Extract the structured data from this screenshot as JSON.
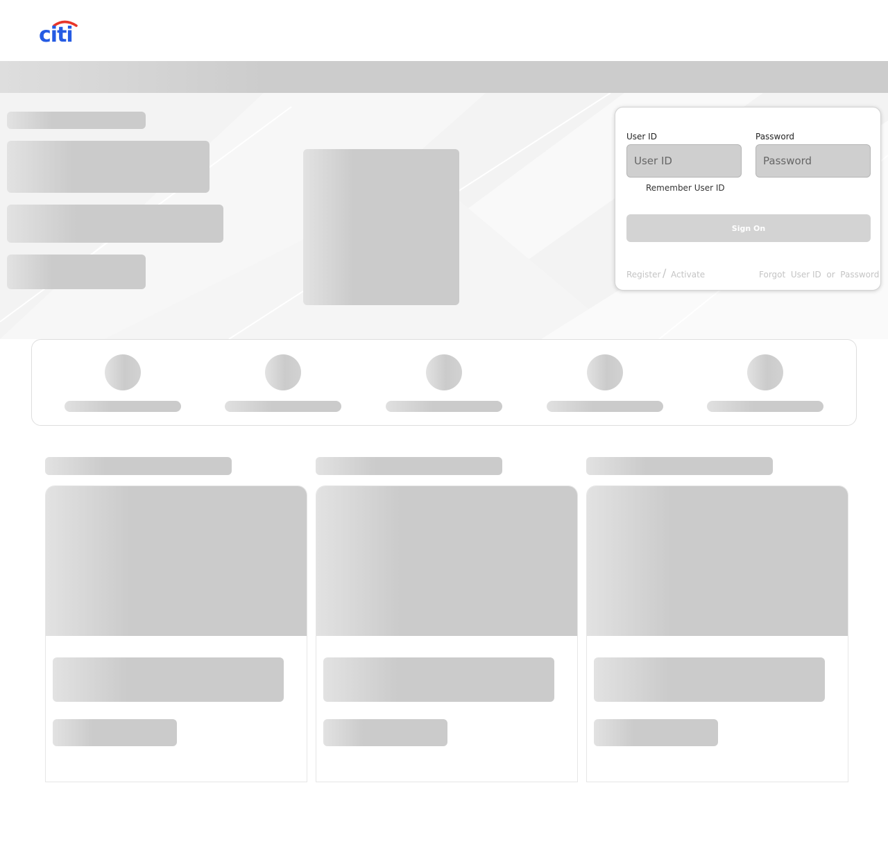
{
  "brand": {
    "logo_text": "citi",
    "logo_text_color": "#255be3",
    "logo_arc_color": "#e8362a"
  },
  "signon": {
    "user_id_label": "User ID",
    "user_id_placeholder": "User ID",
    "password_label": "Password",
    "password_placeholder": "Password",
    "remember_label": "Remember User ID",
    "sign_on_label": "Sign On",
    "register_label": "Register",
    "separator": "/",
    "activate_label": "Activate",
    "forgot_label": "Forgot  User ID  or  Password"
  },
  "colors": {
    "placeholder_skeleton": "#cbcbcb",
    "page_background": "#ffffff",
    "hero_background": "#f3f3f3"
  }
}
